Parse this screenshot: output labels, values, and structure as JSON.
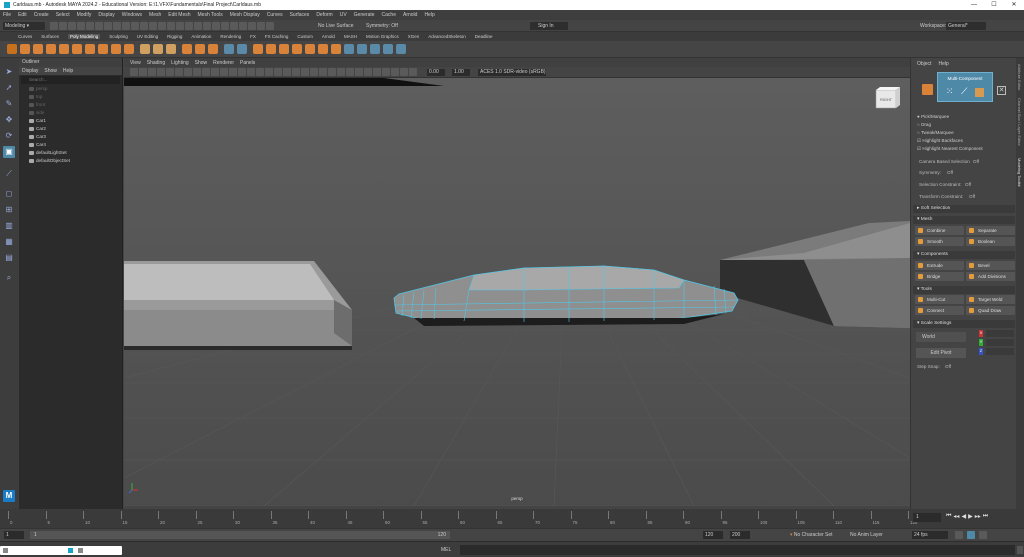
{
  "window": {
    "title": "Carldaus.mb - Autodesk MAYA 2024.2 - Educational Version: E:\\1.VFX\\Fundamentals\\Final Project\\Carldaus.mb"
  },
  "menubar": [
    "File",
    "Edit",
    "Create",
    "Select",
    "Modify",
    "Display",
    "Windows",
    "Mesh",
    "Edit Mesh",
    "Mesh Tools",
    "Mesh Display",
    "Curves",
    "Surfaces",
    "Deform",
    "UV",
    "Generate",
    "Cache",
    "Arnold",
    "Help"
  ],
  "statusline": {
    "mode": "Modeling",
    "no_live": "No Live Surface",
    "symmetry": "Symmetry: Off",
    "signin": "Sign In",
    "workspace_label": "Workspace:",
    "workspace": "General*"
  },
  "shelf_tabs": [
    "Curves",
    "Surfaces",
    "Poly Modeling",
    "Sculpting",
    "UV Editing",
    "Rigging",
    "Animation",
    "Rendering",
    "FX",
    "FX Caching",
    "Custom",
    "Arnold",
    "MASH",
    "Motion Graphics",
    "XGen",
    "AdvancedSkeleton",
    "Deadline"
  ],
  "shelf_active": "Poly Modeling",
  "outliner": {
    "title": "Outliner",
    "menu": [
      "Display",
      "Show",
      "Help"
    ],
    "search_placeholder": "Search...",
    "items": [
      {
        "label": "persp",
        "dim": true
      },
      {
        "label": "top",
        "dim": true
      },
      {
        "label": "front",
        "dim": true
      },
      {
        "label": "side",
        "dim": true
      },
      {
        "label": "Car1",
        "dim": false
      },
      {
        "label": "Car2",
        "dim": false
      },
      {
        "label": "Car3",
        "dim": false
      },
      {
        "label": "Car4",
        "dim": false
      },
      {
        "label": "defaultLightSet",
        "dim": false
      },
      {
        "label": "defaultObjectSet",
        "dim": false
      }
    ]
  },
  "viewport": {
    "menu": [
      "View",
      "Shading",
      "Lighting",
      "Show",
      "Renderer",
      "Panels"
    ],
    "val1": "0.00",
    "val2": "1.00",
    "colorspace": "ACES 1.0 SDR-video (sRGB)",
    "camera": "persp",
    "viewcube": "RIGHT"
  },
  "modeling_toolkit": {
    "menu": [
      "Object",
      "Help"
    ],
    "mode": "Multi-Component",
    "options": [
      "Pick/Marquee",
      "Drag",
      "Tweak/Marquee",
      "Highlight Backfaces",
      "Highlight Nearest Component"
    ],
    "camera_based": "Camera Based Selection",
    "symmetry": "Symmetry:",
    "sel_constraint": "Selection Constraint:",
    "xform_constraint": "Transform Constraint:",
    "off": "Off",
    "soft_selection": "Soft Selection",
    "mesh_title": "Mesh",
    "mesh_buttons": [
      "Combine",
      "Separate",
      "Smooth",
      "Boolean"
    ],
    "components_title": "Components",
    "comp_buttons": [
      "Extrude",
      "Bevel",
      "Bridge",
      "Add Divisions"
    ],
    "tools_title": "Tools",
    "tool_buttons": [
      "Multi-Cut",
      "Target Weld",
      "Connect",
      "Quad Draw"
    ],
    "scale_title": "Scale Settings",
    "world": "World",
    "edit_pivot": "Edit Pivot",
    "xyz": [
      "X",
      "Y",
      "Z"
    ],
    "step_snap": "Step Snap:"
  },
  "side_tabs": [
    "Modeling Toolkit",
    "Channel Box / Layer Editor",
    "Attribute Editor"
  ],
  "timeline": {
    "ticks": [
      "0",
      "5",
      "10",
      "15",
      "20",
      "25",
      "30",
      "35",
      "40",
      "45",
      "50",
      "55",
      "60",
      "65",
      "70",
      "75",
      "80",
      "85",
      "90",
      "95",
      "100",
      "105",
      "110",
      "115",
      "120"
    ],
    "current": "1"
  },
  "range": {
    "start": "1",
    "start2": "1",
    "end": "120",
    "end2": "120",
    "end3": "200",
    "character": "No Character Set",
    "anim_layer": "No Anim Layer",
    "fps": "24 fps"
  },
  "cmdline": {
    "lang": "MEL"
  }
}
